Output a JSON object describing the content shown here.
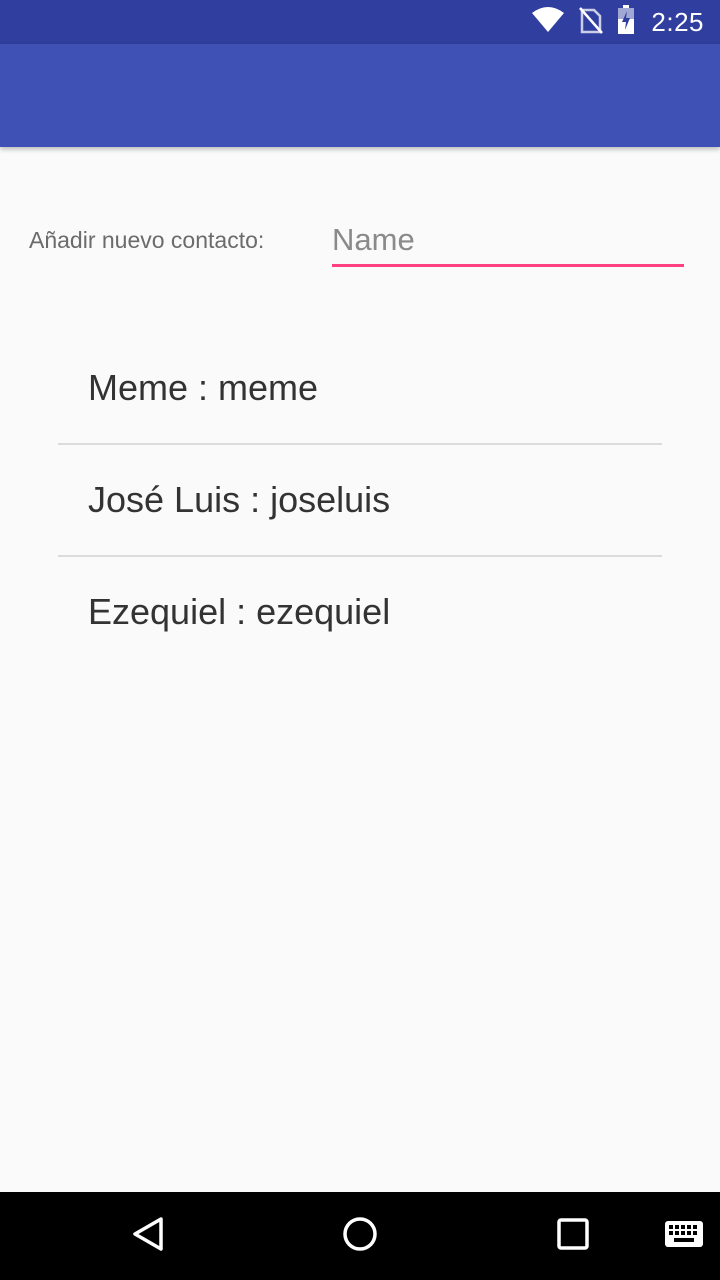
{
  "status_bar": {
    "time": "2:25",
    "icons": [
      "wifi-icon",
      "no-sim-icon",
      "battery-charging-icon"
    ]
  },
  "app_bar": {
    "color": "#3f51b5"
  },
  "form": {
    "label": "Añadir nuevo contacto:",
    "name_placeholder": "Name",
    "name_value": "",
    "accent_color": "#ff4081"
  },
  "contacts": [
    {
      "text": "Meme : meme"
    },
    {
      "text": "José Luis : joseluis"
    },
    {
      "text": "Ezequiel : ezequiel"
    }
  ],
  "nav_bar": {
    "buttons": [
      "back-icon",
      "home-icon",
      "recents-icon",
      "keyboard-icon"
    ]
  }
}
